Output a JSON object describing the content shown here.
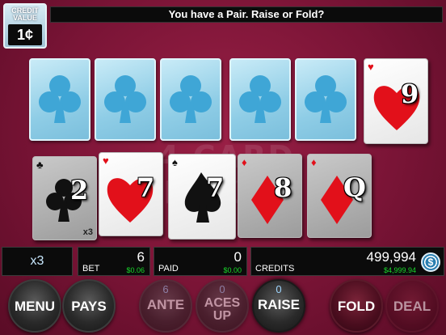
{
  "header": {
    "message": "You have a Pair. Raise or Fold?"
  },
  "credit_value": {
    "label": "CREDIT VALUE",
    "value": "1¢"
  },
  "watermark": "4 CARD POKER",
  "dealer_cards": [
    {
      "face": "back"
    },
    {
      "face": "back"
    },
    {
      "face": "back"
    },
    {
      "face": "back"
    },
    {
      "face": "back"
    },
    {
      "face": "up",
      "rank": "9",
      "suit": "hearts"
    }
  ],
  "player_cards": [
    {
      "rank": "2",
      "suit": "clubs",
      "tag": "x3"
    },
    {
      "rank": "7",
      "suit": "hearts"
    },
    {
      "rank": "7",
      "suit": "spades"
    },
    {
      "rank": "8",
      "suit": "diamonds"
    },
    {
      "rank": "Q",
      "suit": "diamonds"
    }
  ],
  "multiplier": "x3",
  "bet": {
    "label": "BET",
    "value": "6",
    "money": "$0.06"
  },
  "paid": {
    "label": "PAID",
    "value": "0",
    "money": "$0.00"
  },
  "credits": {
    "label": "CREDITS",
    "value": "499,994",
    "money": "$4,999.94"
  },
  "chip_icon": "$",
  "buttons": {
    "menu": "MENU",
    "pays": "PAYS",
    "ante": {
      "count": "6",
      "label": "ANTE"
    },
    "aces_up": {
      "count": "0",
      "label": "ACES UP"
    },
    "raise": {
      "count": "0",
      "label": "RAISE"
    },
    "fold": "FOLD",
    "deal": "DEAL"
  },
  "colors": {
    "felt": "#7a1436",
    "hearts": "#e2101a",
    "diamonds": "#e2101a",
    "clubs": "#111111",
    "spades": "#111111",
    "back": "#9fd8ee",
    "money": "#19d92b"
  }
}
